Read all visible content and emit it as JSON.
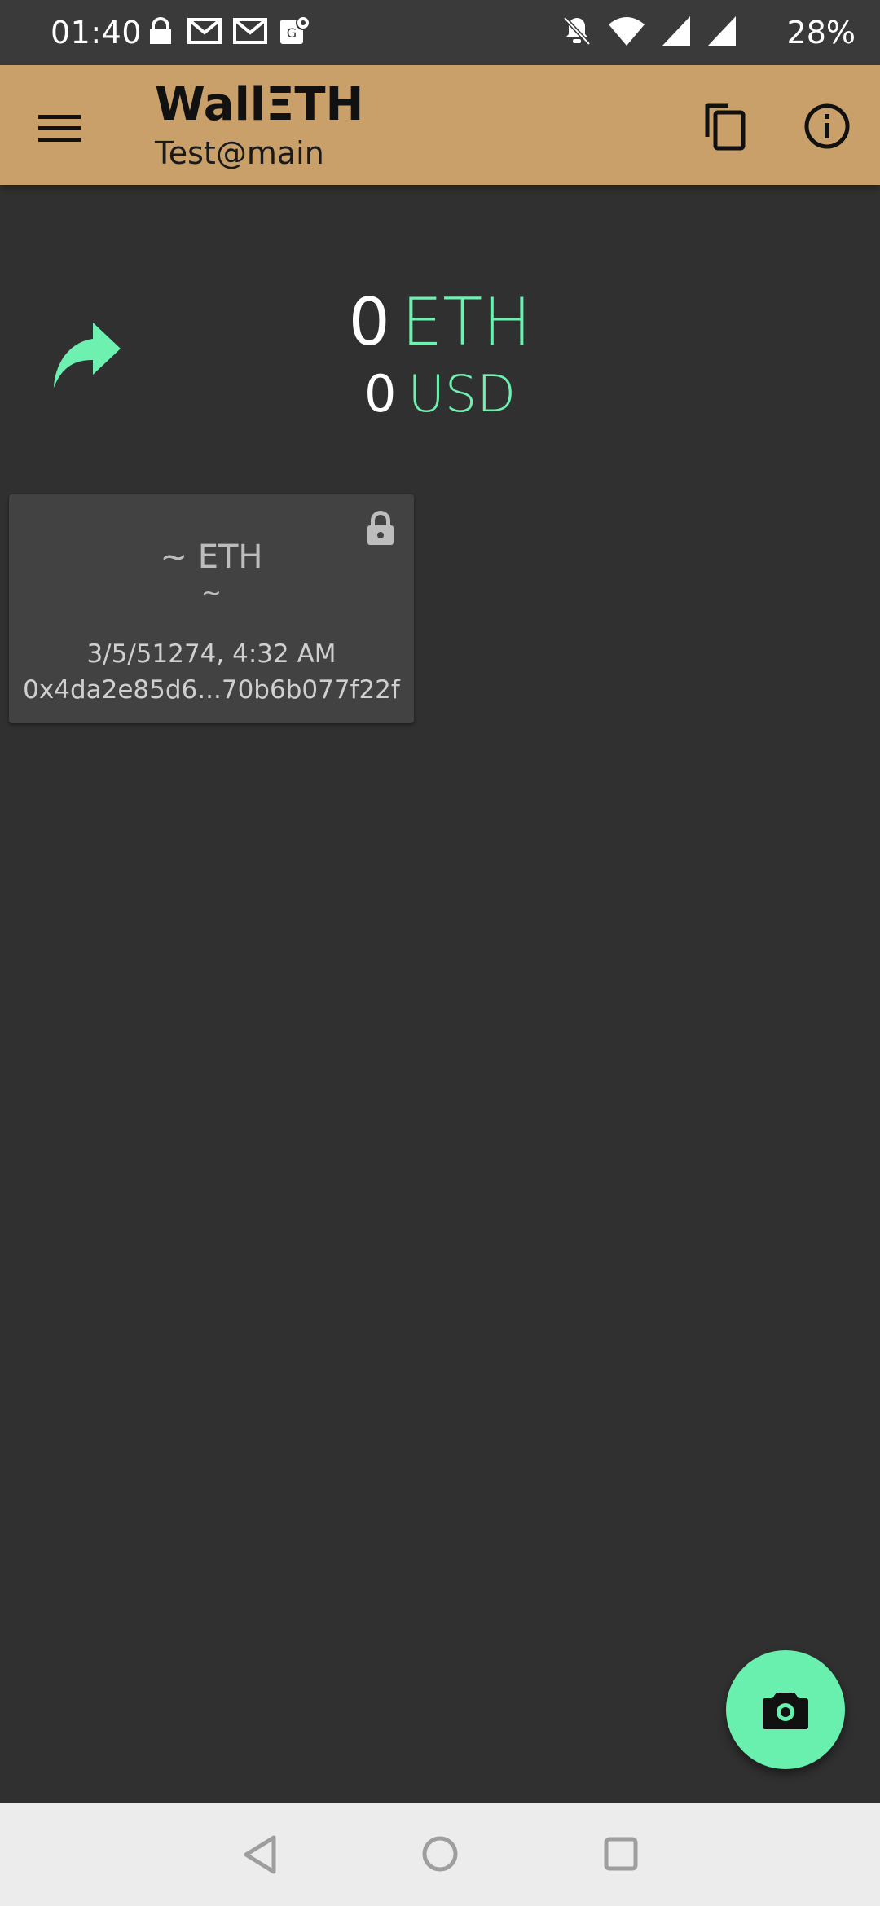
{
  "status_bar": {
    "time": "01:40",
    "battery": "28%",
    "left_icons": [
      "lock-notification-icon",
      "gmail-icon",
      "gmail-icon",
      "maps-icon"
    ],
    "right_icons": [
      "bell-off-icon",
      "wifi-icon",
      "signal-icon",
      "signal-icon"
    ]
  },
  "app_bar": {
    "title": "WallΞTH",
    "subtitle": "Test@main",
    "color": "#c9a06a"
  },
  "balance": {
    "eth_amount": "0",
    "eth_unit": "ETH",
    "fiat_amount": "0",
    "fiat_unit": "USD",
    "accent_color": "#6ef0b0"
  },
  "transactions": [
    {
      "value_line": "~  ETH",
      "fiat_line": "~",
      "date": "3/5/51274, 4:32 AM",
      "address": "0x4da2e85d6...70b6b077f22f"
    }
  ],
  "fab": {
    "icon": "camera-icon",
    "color": "#69f0ae"
  }
}
